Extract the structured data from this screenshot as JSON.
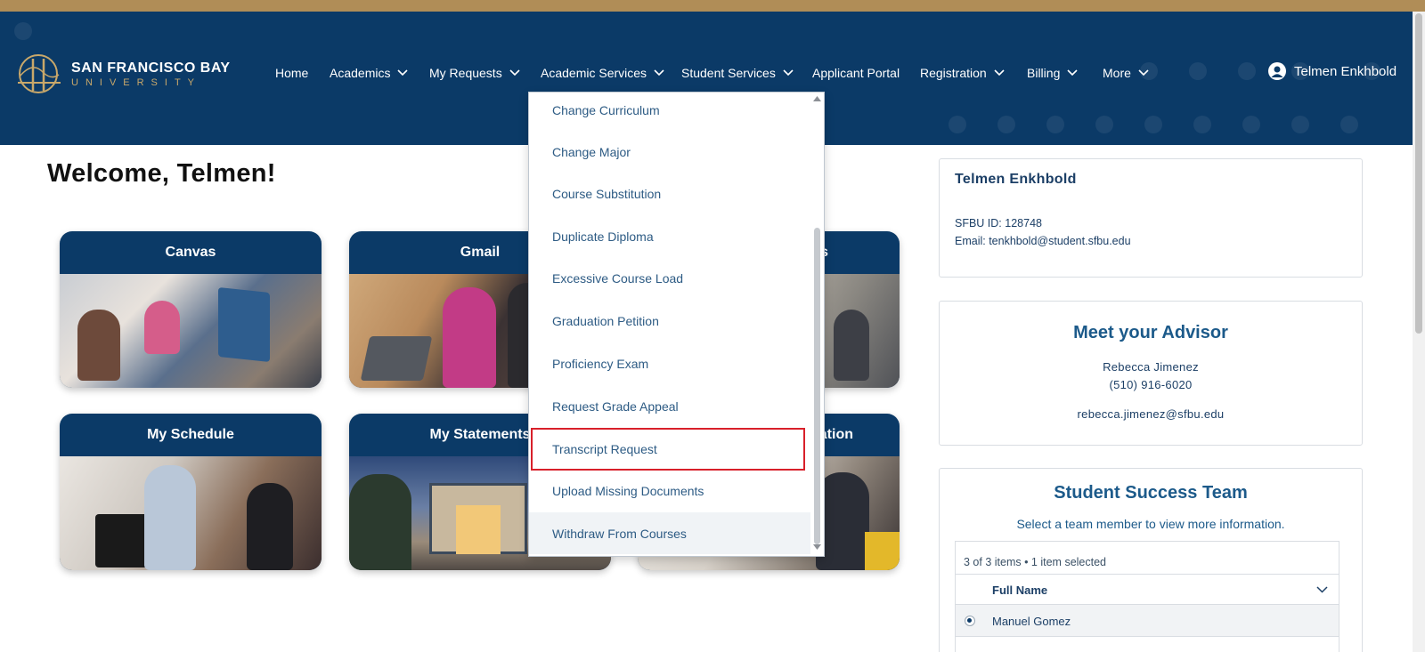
{
  "header": {
    "logo_line1": "SAN FRANCISCO BAY",
    "logo_line2": "UNIVERSITY",
    "nav": [
      {
        "label": "Home"
      },
      {
        "label": "Academics"
      },
      {
        "label": "My Requests"
      },
      {
        "label": "Academic Services"
      },
      {
        "label": "Student Services"
      },
      {
        "label": "Applicant Portal"
      },
      {
        "label": "Registration"
      },
      {
        "label": "Billing"
      },
      {
        "label": "More"
      }
    ],
    "user_name": "Telmen Enkhbold"
  },
  "welcome": "Welcome, Telmen!",
  "tiles": [
    {
      "label": "Canvas"
    },
    {
      "label": "Gmail"
    },
    {
      "label": "s"
    },
    {
      "label": "My Schedule"
    },
    {
      "label": "My Statements"
    },
    {
      "label": "nation"
    }
  ],
  "dropdown": {
    "items": [
      {
        "label": "Change Curriculum"
      },
      {
        "label": "Change Major"
      },
      {
        "label": "Course Substitution"
      },
      {
        "label": "Duplicate Diploma"
      },
      {
        "label": "Excessive Course Load"
      },
      {
        "label": "Graduation Petition"
      },
      {
        "label": "Proficiency Exam"
      },
      {
        "label": "Request Grade Appeal"
      },
      {
        "label": "Transcript Request"
      },
      {
        "label": "Upload Missing Documents"
      },
      {
        "label": "Withdraw From Courses"
      }
    ],
    "highlighted": "Transcript Request"
  },
  "profile": {
    "name": "Telmen Enkhbold",
    "id_line": "SFBU ID: 128748",
    "email_line": "Email: tenkhbold@student.sfbu.edu"
  },
  "advisor": {
    "title": "Meet your Advisor",
    "name": "Rebecca Jimenez",
    "phone": "(510) 916-6020",
    "email": "rebecca.jimenez@sfbu.edu"
  },
  "team": {
    "title": "Student Success Team",
    "subtitle": "Select a team member to view more information.",
    "grid_info": "3 of 3 items • 1 item selected",
    "column_header": "Full Name",
    "rows": [
      {
        "name": "Manuel Gomez"
      }
    ]
  },
  "colors": {
    "navy": "#0b3a67",
    "gold": "#b08d57",
    "highlight_border": "#d8202a"
  }
}
